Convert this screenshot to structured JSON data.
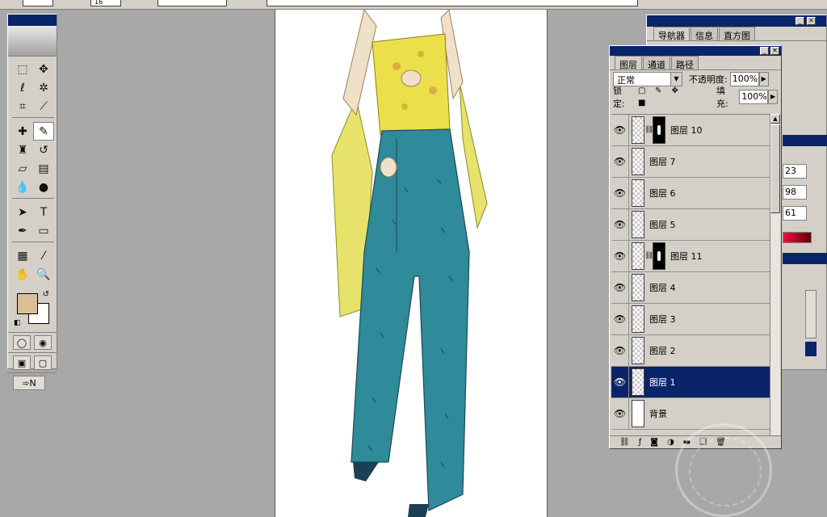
{
  "menubar": {
    "zoom_value": "16",
    "hint_text": ""
  },
  "toolbox": {
    "tools": [
      {
        "name": "marquee-tool-icon",
        "glyph": "⬚"
      },
      {
        "name": "move-tool-icon",
        "glyph": "✥"
      },
      {
        "name": "lasso-tool-icon",
        "glyph": "ℓ"
      },
      {
        "name": "magic-wand-icon",
        "glyph": "✲"
      },
      {
        "name": "crop-tool-icon",
        "glyph": "⌗"
      },
      {
        "name": "slice-tool-icon",
        "glyph": "⟋"
      },
      {
        "name": "healing-brush-icon",
        "glyph": "✚"
      },
      {
        "name": "brush-tool-icon",
        "glyph": "✎"
      },
      {
        "name": "clone-stamp-icon",
        "glyph": "♜"
      },
      {
        "name": "history-brush-icon",
        "glyph": "↺"
      },
      {
        "name": "eraser-tool-icon",
        "glyph": "▱"
      },
      {
        "name": "gradient-tool-icon",
        "glyph": "▤"
      },
      {
        "name": "blur-tool-icon",
        "glyph": "💧"
      },
      {
        "name": "burn-tool-icon",
        "glyph": "●"
      },
      {
        "name": "path-select-icon",
        "glyph": "➤"
      },
      {
        "name": "type-tool-icon",
        "glyph": "T"
      },
      {
        "name": "pen-tool-icon",
        "glyph": "✒"
      },
      {
        "name": "shape-tool-icon",
        "glyph": "▭"
      },
      {
        "name": "notes-tool-icon",
        "glyph": "▦"
      },
      {
        "name": "eyedropper-icon",
        "glyph": "⁄"
      },
      {
        "name": "hand-tool-icon",
        "glyph": "✋"
      },
      {
        "name": "zoom-tool-icon",
        "glyph": "🔍"
      }
    ],
    "colors": {
      "foreground": "#d9bf98",
      "background": "#ffffff"
    }
  },
  "navigator_panel": {
    "tabs": [
      "导航器",
      "信息",
      "直方图"
    ],
    "fields": [
      "23",
      "98",
      "61"
    ]
  },
  "layers_panel": {
    "tabs": [
      "图层",
      "通道",
      "路径"
    ],
    "blend_mode": "正常",
    "opacity_label": "不透明度:",
    "opacity_value": "100%",
    "lock_label": "锁定:",
    "fill_label": "填充:",
    "fill_value": "100%",
    "layers": [
      {
        "name": "图层 10",
        "mask": true,
        "selected": false
      },
      {
        "name": "图层 7",
        "mask": false,
        "selected": false
      },
      {
        "name": "图层 6",
        "mask": false,
        "selected": false
      },
      {
        "name": "图层 5",
        "mask": false,
        "selected": false
      },
      {
        "name": "图层 11",
        "mask": true,
        "selected": false
      },
      {
        "name": "图层 4",
        "mask": false,
        "selected": false
      },
      {
        "name": "图层 3",
        "mask": false,
        "selected": false
      },
      {
        "name": "图层 2",
        "mask": false,
        "selected": false
      },
      {
        "name": "图层 1",
        "mask": false,
        "selected": true
      },
      {
        "name": "背景",
        "mask": false,
        "selected": false,
        "background": true
      }
    ]
  },
  "accent_color": "#0a246a"
}
